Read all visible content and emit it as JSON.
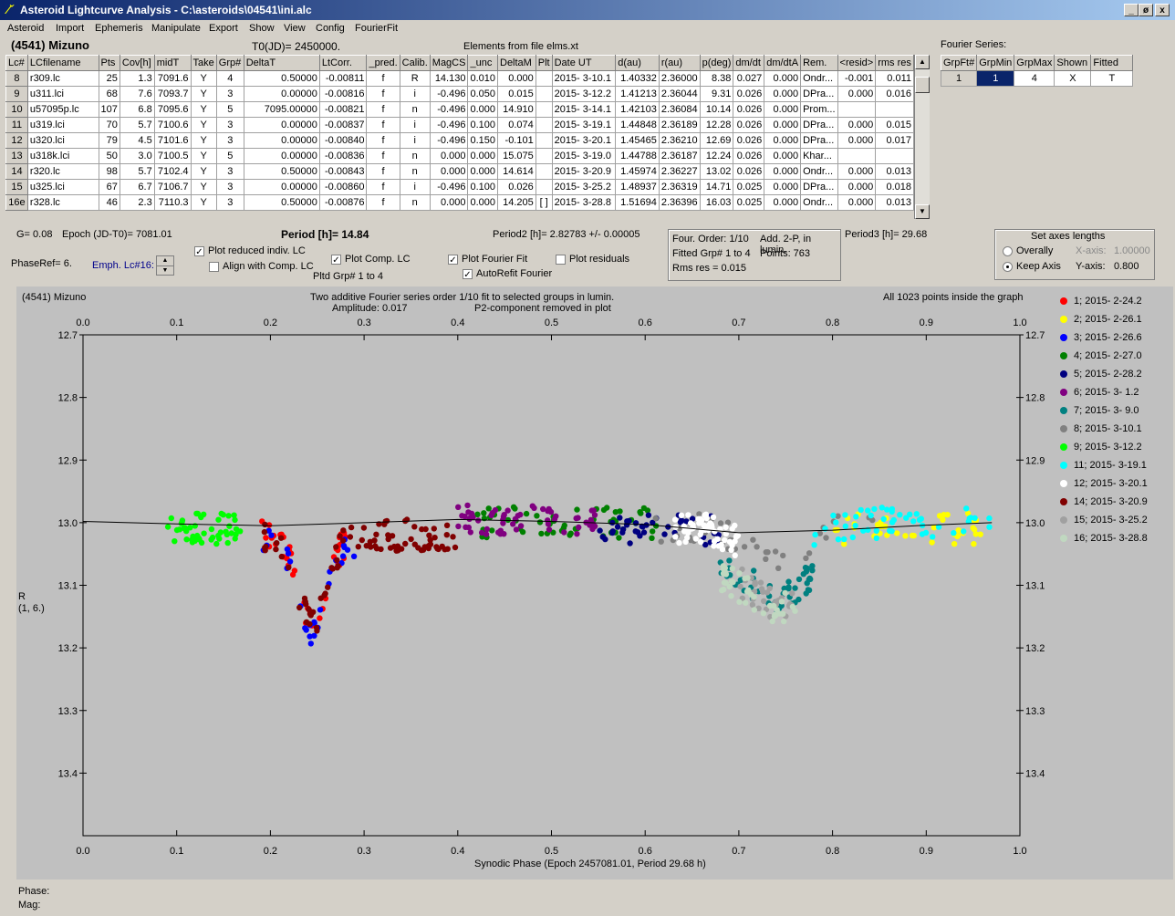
{
  "window": {
    "title": "Asteroid Lightcurve Analysis - C:\\asteroids\\04541\\ini.alc",
    "app_icon": "alc-app-icon",
    "controls": [
      "_",
      "ø",
      "x"
    ]
  },
  "menu": [
    "Asteroid",
    "Import",
    "Ephemeris",
    "Manipulate",
    "Export",
    "Show",
    "View",
    "Config",
    "FourierFit"
  ],
  "header": {
    "asteroid": "(4541) Mizuno",
    "t0": "T0(JD)= 2450000.",
    "elements": "Elements from file elms.xt"
  },
  "table": {
    "columns": [
      "Lc#",
      "LCfilename",
      "Pts",
      "Cov[h]",
      "midT",
      "Take",
      "Grp#",
      "DeltaT",
      "LtCorr.",
      "_pred.",
      "Calib.",
      "MagCS",
      "_unc",
      "DeltaM",
      "Plt",
      "Date UT",
      "d(au)",
      "r(au)",
      "p(deg)",
      "dm/dt",
      "dm/dtA",
      "Rem.",
      "<resid>",
      "rms res"
    ],
    "rows": [
      [
        "8",
        "r309.lc",
        "25",
        "1.3",
        "7091.6",
        "Y",
        "4",
        "0.50000",
        "-0.00811",
        "f",
        "R",
        "14.130",
        "0.010",
        "0.000",
        "",
        "2015- 3-10.1",
        "1.40332",
        "2.36000",
        "8.38",
        "0.027",
        "0.000",
        "Ondr...",
        "-0.001",
        "0.011"
      ],
      [
        "9",
        "u311.lci",
        "68",
        "7.6",
        "7093.7",
        "Y",
        "3",
        "0.00000",
        "-0.00816",
        "f",
        "i",
        "-0.496",
        "0.050",
        "0.015",
        "",
        "2015- 3-12.2",
        "1.41213",
        "2.36044",
        "9.31",
        "0.026",
        "0.000",
        "DPra...",
        "0.000",
        "0.016"
      ],
      [
        "10",
        "u57095p.lc",
        "107",
        "6.8",
        "7095.6",
        "Y",
        "5",
        "7095.00000",
        "-0.00821",
        "f",
        "n",
        "-0.496",
        "0.000",
        "14.910",
        "",
        "2015- 3-14.1",
        "1.42103",
        "2.36084",
        "10.14",
        "0.026",
        "0.000",
        "Prom...",
        "",
        ""
      ],
      [
        "11",
        "u319.lci",
        "70",
        "5.7",
        "7100.6",
        "Y",
        "3",
        "0.00000",
        "-0.00837",
        "f",
        "i",
        "-0.496",
        "0.100",
        "0.074",
        "",
        "2015- 3-19.1",
        "1.44848",
        "2.36189",
        "12.28",
        "0.026",
        "0.000",
        "DPra...",
        "0.000",
        "0.015"
      ],
      [
        "12",
        "u320.lci",
        "79",
        "4.5",
        "7101.6",
        "Y",
        "3",
        "0.00000",
        "-0.00840",
        "f",
        "i",
        "-0.496",
        "0.150",
        "-0.101",
        "",
        "2015- 3-20.1",
        "1.45465",
        "2.36210",
        "12.69",
        "0.026",
        "0.000",
        "DPra...",
        "0.000",
        "0.017"
      ],
      [
        "13",
        "u318k.lci",
        "50",
        "3.0",
        "7100.5",
        "Y",
        "5",
        "0.00000",
        "-0.00836",
        "f",
        "n",
        "0.000",
        "0.000",
        "15.075",
        "",
        "2015- 3-19.0",
        "1.44788",
        "2.36187",
        "12.24",
        "0.026",
        "0.000",
        "Khar...",
        "",
        ""
      ],
      [
        "14",
        "r320.lc",
        "98",
        "5.7",
        "7102.4",
        "Y",
        "3",
        "0.50000",
        "-0.00843",
        "f",
        "n",
        "0.000",
        "0.000",
        "14.614",
        "",
        "2015- 3-20.9",
        "1.45974",
        "2.36227",
        "13.02",
        "0.026",
        "0.000",
        "Ondr...",
        "0.000",
        "0.013"
      ],
      [
        "15",
        "u325.lci",
        "67",
        "6.7",
        "7106.7",
        "Y",
        "3",
        "0.00000",
        "-0.00860",
        "f",
        "i",
        "-0.496",
        "0.100",
        "0.026",
        "",
        "2015- 3-25.2",
        "1.48937",
        "2.36319",
        "14.71",
        "0.025",
        "0.000",
        "DPra...",
        "0.000",
        "0.018"
      ],
      [
        "16e",
        "r328.lc",
        "46",
        "2.3",
        "7110.3",
        "Y",
        "3",
        "0.50000",
        "-0.00876",
        "f",
        "n",
        "0.000",
        "0.000",
        "14.205",
        "[ ]",
        "2015- 3-28.8",
        "1.51694",
        "2.36396",
        "16.03",
        "0.025",
        "0.000",
        "Ondr...",
        "0.000",
        "0.013"
      ]
    ]
  },
  "fourier": {
    "label": "Fourier Series:",
    "columns": [
      "GrpFt#",
      "GrpMin",
      "GrpMax",
      "Shown",
      "Fitted"
    ],
    "row": [
      "1",
      "1",
      "4",
      "X",
      "T"
    ]
  },
  "info": {
    "g": "G= 0.08",
    "epoch": "Epoch (JD-T0)= 7081.01",
    "period": "Period [h]= 14.84",
    "period2": "Period2 [h]= 2.82783 +/- 0.00005",
    "period3": "Period3 [h]= 29.68",
    "phaseref": "PhaseRef= 6.",
    "emph": "Emph. Lc#16:",
    "pltd": "Pltd Grp#  1   to   4",
    "four_order": "Four. Order:  1/10",
    "add2p": "Add. 2-P, in lumin.",
    "fitted": "Fitted Grp# 1 to 4",
    "points": "Points: 763",
    "rms": "Rms res     = 0.015"
  },
  "checks": {
    "reduced": {
      "label": "Plot reduced indiv. LC",
      "checked": true
    },
    "align": {
      "label": "Align with Comp. LC",
      "checked": false
    },
    "comp": {
      "label": "Plot Comp. LC",
      "checked": true
    },
    "fourier": {
      "label": "Plot Fourier Fit",
      "checked": true
    },
    "residuals": {
      "label": "Plot residuals",
      "checked": false
    },
    "autorefit": {
      "label": "AutoRefit Fourier",
      "checked": true
    }
  },
  "axes_box": {
    "title": "Set axes lengths",
    "overally": "Overally",
    "keepaxis": "Keep Axis",
    "xaxis_label": "X-axis:",
    "xaxis_value": "1.00000",
    "yaxis_label": "Y-axis:",
    "yaxis_value": "0.800"
  },
  "plot": {
    "corner": "(4541) Mizuno",
    "title1": "Two additive Fourier series order 1/10 fit to selected groups in lumin.",
    "title2": "Amplitude: 0.017",
    "title3": "P2-component removed in plot",
    "inside": "All 1023 points inside the graph",
    "ylabel1": "R",
    "ylabel2": "(1, 6.)",
    "xlabel": "Synodic Phase (Epoch 2457081.01, Period 29.68 h)"
  },
  "status": {
    "phase": "Phase:",
    "mag": "Mag:"
  },
  "chart_data": {
    "type": "scatter",
    "x_range": [
      0,
      1
    ],
    "y_range": [
      12.7,
      13.5
    ],
    "y_inverted": true,
    "xticks": [
      "0.0",
      "0.1",
      "0.2",
      "0.3",
      "0.4",
      "0.5",
      "0.6",
      "0.7",
      "0.8",
      "0.9",
      "1.0"
    ],
    "yticks": [
      "12.7",
      "12.8",
      "12.9",
      "13.0",
      "13.1",
      "13.2",
      "13.3",
      "13.4"
    ],
    "fit_curve": [
      [
        0.0,
        12.998
      ],
      [
        0.1,
        13.002
      ],
      [
        0.2,
        13.005
      ],
      [
        0.3,
        13.0
      ],
      [
        0.4,
        12.995
      ],
      [
        0.5,
        12.998
      ],
      [
        0.6,
        13.003
      ],
      [
        0.7,
        13.016
      ],
      [
        0.8,
        13.012
      ],
      [
        0.9,
        13.004
      ],
      [
        0.97,
        13.0
      ]
    ],
    "series": [
      {
        "name": "1; 2015- 2-24.2",
        "color": "#ff0000",
        "range": [
          [
            0.19,
            0.28
          ]
        ],
        "mag": 13.02,
        "n": 40
      },
      {
        "name": "2; 2015- 2-26.1",
        "color": "#ffff00",
        "range": [
          [
            0.8,
            0.97
          ]
        ],
        "mag": 13.01,
        "n": 40
      },
      {
        "name": "3; 2015- 2-26.6",
        "color": "#0000ff",
        "range": [
          [
            0.19,
            0.29
          ]
        ],
        "mag": 13.03,
        "n": 30
      },
      {
        "name": "4; 2015- 2-27.0",
        "color": "#008000",
        "range": [
          [
            0.42,
            0.62
          ]
        ],
        "mag": 13.0,
        "n": 60
      },
      {
        "name": "5; 2015- 2-28.2",
        "color": "#000080",
        "range": [
          [
            0.55,
            0.68
          ]
        ],
        "mag": 13.01,
        "n": 40
      },
      {
        "name": "6; 2015- 3- 1.2",
        "color": "#800080",
        "range": [
          [
            0.4,
            0.55
          ]
        ],
        "mag": 12.995,
        "n": 60
      },
      {
        "name": "7; 2015- 3- 9.0",
        "color": "#008080",
        "range": [
          [
            0.68,
            0.78
          ]
        ],
        "mag": 13.06,
        "n": 50
      },
      {
        "name": "8; 2015- 3-10.1",
        "color": "#808080",
        "range": [
          [
            0.6,
            0.85
          ]
        ],
        "mag": 13.01,
        "n": 40
      },
      {
        "name": "9; 2015- 3-12.2",
        "color": "#00ff00",
        "range": [
          [
            0.09,
            0.17
          ]
        ],
        "mag": 13.01,
        "n": 50
      },
      {
        "name": "11; 2015- 3-19.1",
        "color": "#00ffff",
        "range": [
          [
            0.78,
            0.97
          ]
        ],
        "mag": 13.0,
        "n": 50
      },
      {
        "name": "12; 2015- 3-20.1",
        "color": "#ffffff",
        "range": [
          [
            0.63,
            0.7
          ]
        ],
        "mag": 13.01,
        "n": 60
      },
      {
        "name": "14; 2015- 3-20.9",
        "color": "#800000",
        "range": [
          [
            0.19,
            0.4
          ]
        ],
        "mag": 13.02,
        "n": 90
      },
      {
        "name": "15; 2015- 3-25.2",
        "color": "#a0a0a0",
        "range": [
          [
            0.7,
            0.76
          ]
        ],
        "mag": 13.07,
        "n": 30
      },
      {
        "name": "16; 2015- 3-28.8",
        "color": "#c0d8c0",
        "range": [
          [
            0.68,
            0.76
          ]
        ],
        "mag": 13.08,
        "n": 40
      }
    ]
  }
}
